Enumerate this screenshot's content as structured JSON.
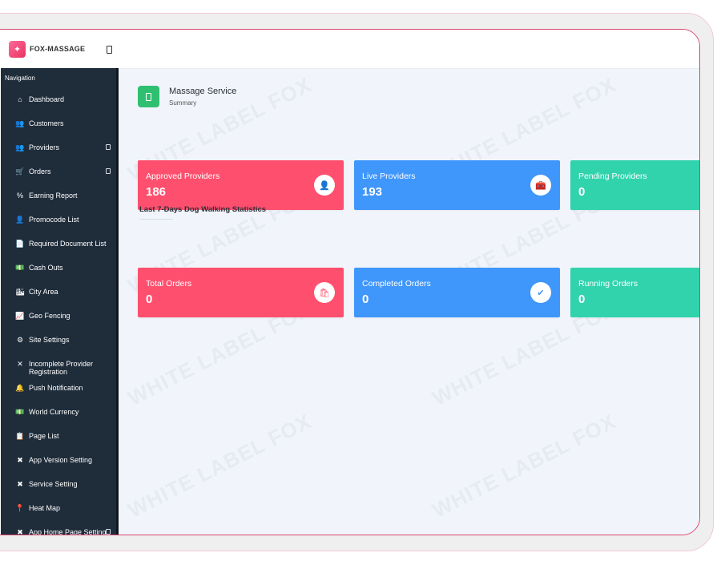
{
  "header": {
    "app_name": "FOX-MASSAGE"
  },
  "sidebar": {
    "heading": "Navigation",
    "items": [
      {
        "label": "Dashboard",
        "icon": "home-icon",
        "glyph": "⌂",
        "has_sub": false
      },
      {
        "label": "Customers",
        "icon": "users-icon",
        "glyph": "👥",
        "has_sub": false
      },
      {
        "label": "Providers",
        "icon": "providers-icon",
        "glyph": "👥",
        "has_sub": true
      },
      {
        "label": "Orders",
        "icon": "cart-icon",
        "glyph": "🛒",
        "has_sub": true
      },
      {
        "label": "Earning Report",
        "icon": "percent-icon",
        "glyph": "%",
        "has_sub": false
      },
      {
        "label": "Promocode List",
        "icon": "user-tag-icon",
        "glyph": "👤",
        "has_sub": false
      },
      {
        "label": "Required Document List",
        "icon": "document-icon",
        "glyph": "📄",
        "has_sub": false
      },
      {
        "label": "Cash Outs",
        "icon": "money-icon",
        "glyph": "💵",
        "has_sub": false
      },
      {
        "label": "City Area",
        "icon": "city-icon",
        "glyph": "🏙",
        "has_sub": false
      },
      {
        "label": "Geo Fencing",
        "icon": "area-chart-icon",
        "glyph": "📈",
        "has_sub": false
      },
      {
        "label": "Site Settings",
        "icon": "gear-icon",
        "glyph": "⚙",
        "has_sub": false
      },
      {
        "label": "Incomplete Provider Registration",
        "icon": "user-slash-icon",
        "glyph": "✕",
        "has_sub": false
      },
      {
        "label": "Push Notification",
        "icon": "bell-icon",
        "glyph": "🔔",
        "has_sub": false
      },
      {
        "label": "World Currency",
        "icon": "currency-icon",
        "glyph": "💵",
        "has_sub": false
      },
      {
        "label": "Page List",
        "icon": "clipboard-icon",
        "glyph": "📋",
        "has_sub": false
      },
      {
        "label": "App Version Setting",
        "icon": "tools-icon",
        "glyph": "✖",
        "has_sub": false
      },
      {
        "label": "Service Setting",
        "icon": "tools-icon",
        "glyph": "✖",
        "has_sub": false
      },
      {
        "label": "Heat Map",
        "icon": "map-pin-icon",
        "glyph": "📍",
        "has_sub": false
      },
      {
        "label": "App Home Page Setting",
        "icon": "tools-icon",
        "glyph": "✖",
        "has_sub": true
      }
    ]
  },
  "page": {
    "title": "Massage Service",
    "subtitle": "Summary"
  },
  "provider_cards": [
    {
      "title": "Approved Providers",
      "value": "186",
      "color": "#ff4f6e",
      "icon": "user-check-icon",
      "glyph": "👤"
    },
    {
      "title": "Live Providers",
      "value": "193",
      "color": "#3f96fb",
      "icon": "toolbox-icon",
      "glyph": "🧰"
    },
    {
      "title": "Pending Providers",
      "value": "0",
      "color": "#31d3ad",
      "icon": "hourglass-icon",
      "glyph": "⌛"
    }
  ],
  "stats_section": {
    "title": "Last 7-Days Dog Walking Statistics"
  },
  "order_cards": [
    {
      "title": "Total Orders",
      "value": "0",
      "color": "#ff4f6e",
      "icon": "shopping-bag-icon",
      "glyph": "🛍"
    },
    {
      "title": "Completed Orders",
      "value": "0",
      "color": "#3f96fb",
      "icon": "clipboard-check-icon",
      "glyph": "✔"
    },
    {
      "title": "Running Orders",
      "value": "0",
      "color": "#31d3ad",
      "icon": "running-icon",
      "glyph": "⏱"
    }
  ],
  "watermark": "WHITE LABEL FOX"
}
